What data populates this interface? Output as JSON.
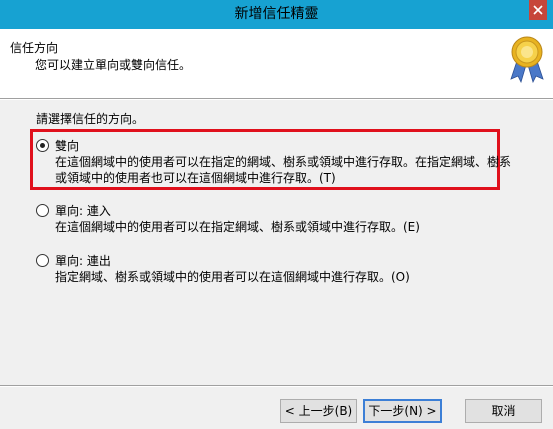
{
  "window": {
    "title": "新增信任精靈"
  },
  "header": {
    "title": "信任方向",
    "subtitle": "您可以建立單向或雙向信任。",
    "icon": "wizard-ribbon-medal-icon"
  },
  "main": {
    "prompt": "請選擇信任的方向。",
    "options": [
      {
        "label": "雙向",
        "description": "在這個網域中的使用者可以在指定的網域、樹系或領域中進行存取。在指定網域、樹系或領域中的使用者也可以在這個網域中進行存取。(T)",
        "selected": true
      },
      {
        "label": "單向: 連入",
        "description": "在這個網域中的使用者可以在指定網域、樹系或領域中進行存取。(E)",
        "selected": false
      },
      {
        "label": "單向: 連出",
        "description": "指定網域、樹系或領域中的使用者可以在這個網域中進行存取。(O)",
        "selected": false
      }
    ]
  },
  "footer": {
    "back_label": "< 上一步(B)",
    "next_label": "下一步(N) >",
    "cancel_label": "取消"
  },
  "colors": {
    "titlebar": "#17a2d2",
    "highlight": "#e0101c",
    "close": "#c7463a"
  }
}
